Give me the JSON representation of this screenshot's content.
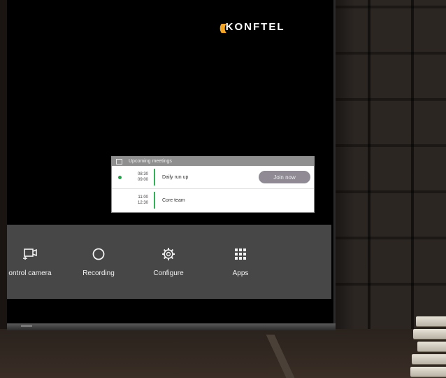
{
  "brand": {
    "name": "KONFTEL",
    "accent": "#f5a623"
  },
  "meetings": {
    "header": "Upcoming meetings",
    "items": [
      {
        "start": "08:30",
        "end": "09:00",
        "title": "Daily run up",
        "active": true,
        "action": "Join now"
      },
      {
        "start": "11:00",
        "end": "12:30",
        "title": "Core team",
        "active": false
      }
    ]
  },
  "toolbar": {
    "items": [
      {
        "label": "ontrol camera",
        "icon": "camera-control-icon"
      },
      {
        "label": "Recording",
        "icon": "record-icon"
      },
      {
        "label": "Configure",
        "icon": "gear-icon"
      },
      {
        "label": "Apps",
        "icon": "apps-grid-icon"
      }
    ]
  },
  "colors": {
    "active_dot": "#21a34a",
    "separator": "#32b256",
    "toolbar_bg": "#474747",
    "join_button": "#8f8a94"
  }
}
